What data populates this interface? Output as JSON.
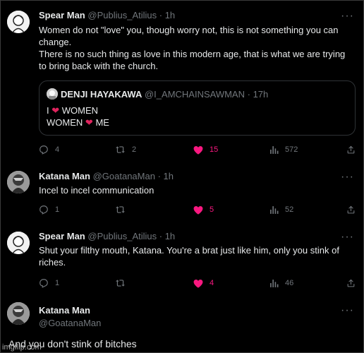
{
  "tweets": [
    {
      "name": "Spear Man",
      "handle": "@Publius_Atilius",
      "time": "· 1h",
      "more": "···",
      "lines": [
        "Women do not \"love\" you, though worry not, this is not something you can change.",
        "There is no such thing as love in this modern age, that is what we are trying to bring back with the church."
      ],
      "quote": {
        "name": "DENJI HAYAKAWA",
        "handle": "@I_AMCHAINSAWMAN",
        "time": "· 17h",
        "line1_a": "I",
        "line1_b": "WOMEN",
        "line2_a": "WOMEN",
        "line2_b": "ME",
        "heart": "❤"
      },
      "replies": "4",
      "retweets": "2",
      "likes": "15",
      "views": "572"
    },
    {
      "name": "Katana Man",
      "handle": "@GoatanaMan",
      "time": "· 1h",
      "more": "···",
      "lines": [
        "Incel to incel communication"
      ],
      "replies": "1",
      "retweets": "",
      "likes": "5",
      "views": "52"
    },
    {
      "name": "Spear Man",
      "handle": "@Publius_Atilius",
      "time": "· 1h",
      "more": "···",
      "lines": [
        "Shut your filthy mouth, Katana. You're a brat just like him, only you stink of riches."
      ],
      "replies": "1",
      "retweets": "",
      "likes": "4",
      "views": "46"
    },
    {
      "name": "Katana Man",
      "handle": "@GoatanaMan",
      "more": "···",
      "lines": [
        "And you don't stink of bitches"
      ]
    }
  ],
  "watermark": "imgflip.com",
  "colors": {
    "background": "#000000",
    "text": "#e7e9ea",
    "muted": "#71767b",
    "like": "#f91880",
    "heart_emoji": "#e0245e"
  },
  "icons": [
    "reply-icon",
    "retweet-icon",
    "like-icon",
    "views-icon",
    "share-icon",
    "more-icon"
  ]
}
